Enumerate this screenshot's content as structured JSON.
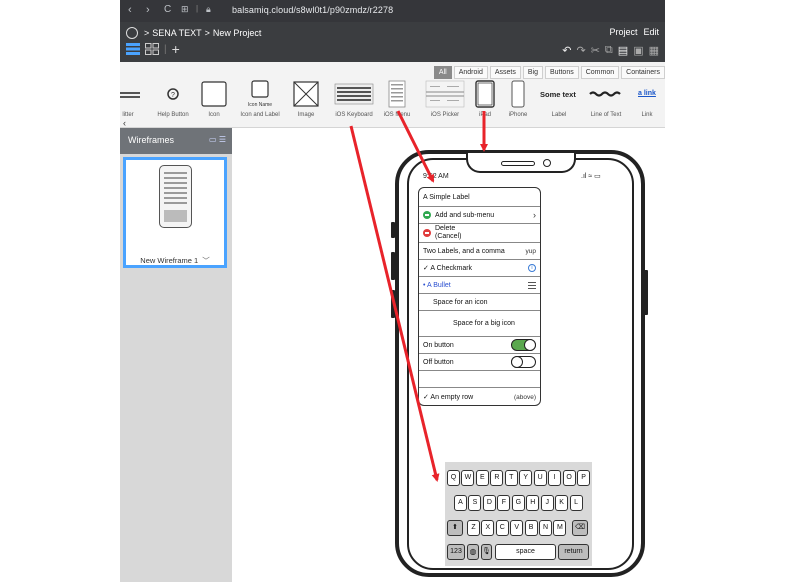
{
  "browser": {
    "url": "balsamiq.cloud/s8wl0t1/p90zmdz/r2278",
    "nav_back": "‹",
    "nav_forward": "›",
    "nav_reload": "C"
  },
  "app": {
    "breadcrumb_project": "SENA TEXT",
    "breadcrumb_separator": ">",
    "breadcrumb_page": "New Project",
    "menu": [
      "Project",
      "Edit"
    ],
    "add_button": "+"
  },
  "library": {
    "tabs": [
      "All",
      "Android",
      "Assets",
      "Big",
      "Buttons",
      "Common",
      "Containers"
    ],
    "active_tab": "All",
    "components": [
      "litter",
      "Help Button",
      "Icon",
      "Icon and Label",
      "Image",
      "iOS Keyboard",
      "iOS Menu",
      "iOS Picker",
      "iPad",
      "iPhone",
      "Label",
      "Line of Text",
      "Link"
    ],
    "icon_label_caption": "Icon Name",
    "label_preview": "Some text",
    "link_preview": "a link",
    "collapse_chevron": "‹"
  },
  "wireframes": {
    "header": "Wireframes",
    "item_name": "New Wireframe 1",
    "item_chevron": "﹀"
  },
  "phone": {
    "time": "9:52 AM",
    "status_icons": ".ıl ≈ ▭"
  },
  "ios_menu": {
    "rows": [
      {
        "label": "A Simple Label"
      },
      {
        "label": "Add and sub-menu",
        "accessory": "›"
      },
      {
        "label": "Delete\n(Cancel)"
      },
      {
        "label": "Two Labels, and a comma",
        "accessory": "yup"
      },
      {
        "label": "✓ A Checkmark"
      },
      {
        "label": "• A Bullet"
      },
      {
        "label": "Space for an icon"
      },
      {
        "label": "Space for a big icon"
      },
      {
        "label": "On button"
      },
      {
        "label": "Off button"
      },
      {
        "label": ""
      },
      {
        "label": "✓ An empty row",
        "accessory": "(above)"
      }
    ]
  },
  "keyboard": {
    "row1": [
      "Q",
      "W",
      "E",
      "R",
      "T",
      "Y",
      "U",
      "I",
      "O",
      "P"
    ],
    "row2": [
      "A",
      "S",
      "D",
      "F",
      "G",
      "H",
      "J",
      "K",
      "L"
    ],
    "row3": [
      "Z",
      "X",
      "C",
      "V",
      "B",
      "N",
      "M"
    ],
    "shift": "⬆",
    "backspace": "⌫",
    "numbers": "123",
    "space": "space",
    "return": "return"
  },
  "colors": {
    "arrow": "#e8232a",
    "selection": "#4aa3ff",
    "toggle_on": "#5aa84e"
  }
}
